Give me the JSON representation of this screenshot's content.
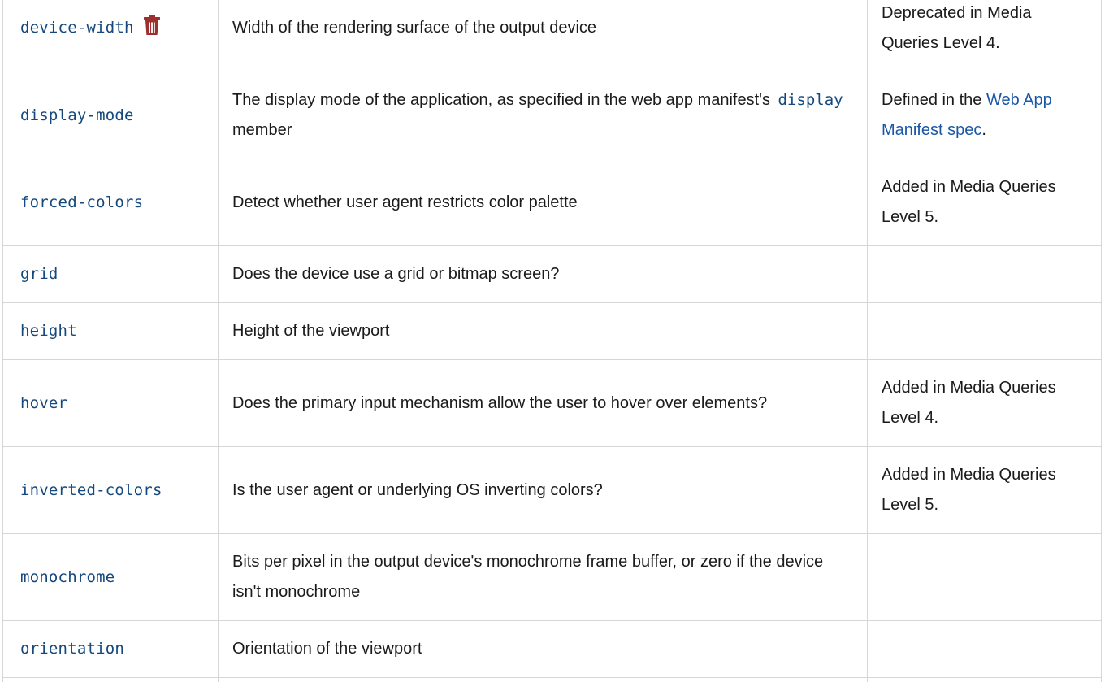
{
  "colors": {
    "code": "#15497e",
    "link": "#1a57a5",
    "text": "#1b1b1b",
    "border": "#d6d6d6",
    "deprecated_icon": "#9e2f2f"
  },
  "rows": [
    {
      "feature": "device-width",
      "deprecated_icon": "trash-icon",
      "description": "Width of the rendering surface of the output device",
      "notes": "Deprecated in Media Queries Level 4."
    },
    {
      "feature": "display-mode",
      "description_prefix": "The display mode of the application, as specified in the web app manifest's",
      "description_code": "display",
      "description_suffix": "member",
      "notes_prefix": "Defined in the",
      "notes_link": "Web App Manifest spec",
      "notes_suffix": "."
    },
    {
      "feature": "forced-colors",
      "description": "Detect whether user agent restricts color palette",
      "notes": "Added in Media Queries Level 5."
    },
    {
      "feature": "grid",
      "description": "Does the device use a grid or bitmap screen?",
      "notes": ""
    },
    {
      "feature": "height",
      "description": "Height of the viewport",
      "notes": ""
    },
    {
      "feature": "hover",
      "description": "Does the primary input mechanism allow the user to hover over elements?",
      "notes": "Added in Media Queries Level 4."
    },
    {
      "feature": "inverted-colors",
      "description": "Is the user agent or underlying OS inverting colors?",
      "notes": "Added in Media Queries Level 5."
    },
    {
      "feature": "monochrome",
      "description": "Bits per pixel in the output device's monochrome frame buffer, or zero if the device isn't monochrome",
      "notes": ""
    },
    {
      "feature": "orientation",
      "description": "Orientation of the viewport",
      "notes": ""
    }
  ]
}
